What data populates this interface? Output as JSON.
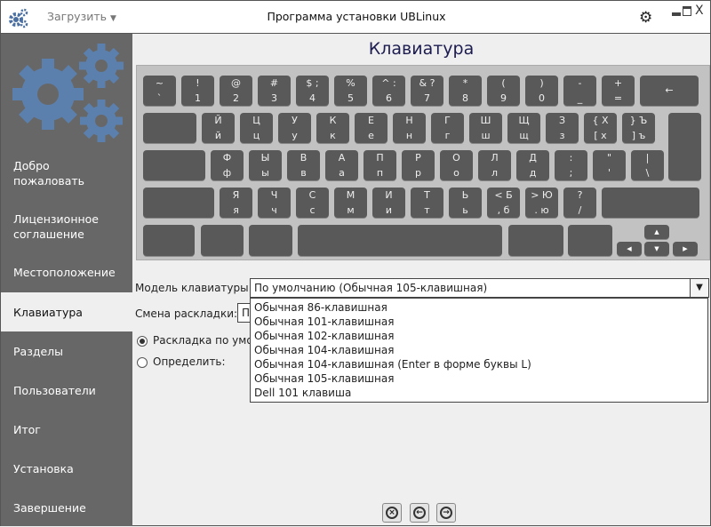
{
  "window": {
    "title": "Программа установки UBLinux",
    "load_menu": "Загрузить"
  },
  "sidebar": {
    "items": [
      {
        "label": "Добро пожаловать"
      },
      {
        "label": "Лицензионное соглашение"
      },
      {
        "label": "Местоположение"
      },
      {
        "label": "Клавиатура",
        "selected": true
      },
      {
        "label": "Разделы"
      },
      {
        "label": "Пользователи"
      },
      {
        "label": "Итог"
      },
      {
        "label": "Установка"
      },
      {
        "label": "Завершение"
      }
    ]
  },
  "page": {
    "title": "Клавиатура"
  },
  "keyboard": {
    "rows": [
      [
        [
          "~",
          "`"
        ],
        [
          "!",
          "1"
        ],
        [
          "@",
          "2"
        ],
        [
          "#",
          "3"
        ],
        [
          "$ ;",
          "4"
        ],
        [
          "%",
          "5"
        ],
        [
          "^ :",
          "6"
        ],
        [
          "& ?",
          "7"
        ],
        [
          "*",
          "8"
        ],
        [
          "(",
          "9"
        ],
        [
          ")",
          "0"
        ],
        [
          "-",
          "_"
        ],
        [
          "+",
          "="
        ],
        [
          "←",
          ""
        ]
      ],
      [
        [
          "",
          ""
        ],
        [
          "Й",
          "й"
        ],
        [
          "Ц",
          "ц"
        ],
        [
          "У",
          "у"
        ],
        [
          "К",
          "к"
        ],
        [
          "Е",
          "е"
        ],
        [
          "Н",
          "н"
        ],
        [
          "Г",
          "г"
        ],
        [
          "Ш",
          "ш"
        ],
        [
          "Щ",
          "щ"
        ],
        [
          "З",
          "з"
        ],
        [
          "{  Х",
          "[  х"
        ],
        [
          "}  Ъ",
          "]  ъ"
        ]
      ],
      [
        [
          "",
          ""
        ],
        [
          "Ф",
          "ф"
        ],
        [
          "Ы",
          "ы"
        ],
        [
          "В",
          "в"
        ],
        [
          "А",
          "а"
        ],
        [
          "П",
          "п"
        ],
        [
          "Р",
          "р"
        ],
        [
          "О",
          "о"
        ],
        [
          "Л",
          "л"
        ],
        [
          "Д",
          "д"
        ],
        [
          ":",
          ";"
        ],
        [
          "\"",
          "'"
        ],
        [
          "|",
          "\\"
        ]
      ],
      [
        [
          "",
          ""
        ],
        [
          "Я",
          "я"
        ],
        [
          "Ч",
          "ч"
        ],
        [
          "С",
          "с"
        ],
        [
          "М",
          "м"
        ],
        [
          "И",
          "и"
        ],
        [
          "Т",
          "т"
        ],
        [
          "Ь",
          "ь"
        ],
        [
          "<  Б",
          ",  б"
        ],
        [
          ">  Ю",
          ".  ю"
        ],
        [
          "?",
          "/"
        ],
        [
          "",
          ""
        ]
      ]
    ],
    "arrows": {
      "up": "▲",
      "left": "◀",
      "down": "▼",
      "right": "▶"
    }
  },
  "form": {
    "model_label": "Модель клавиатуры:",
    "model_value": "По умолчанию (Обычная 105-клавишная)",
    "model_options": [
      "Обычная 86-клавишная",
      "Обычная 101-клавишная",
      "Обычная 102-клавишная",
      "Обычная 104-клавишная",
      "Обычная 104-клавишная (Enter в форме буквы L)",
      "Обычная 105-клавишная",
      "Dell 101 клавиша"
    ],
    "switch_label": "Смена раскладки:",
    "switch_value": "По",
    "radio_default": "Раскладка по умол",
    "radio_detect": "Определить:"
  }
}
